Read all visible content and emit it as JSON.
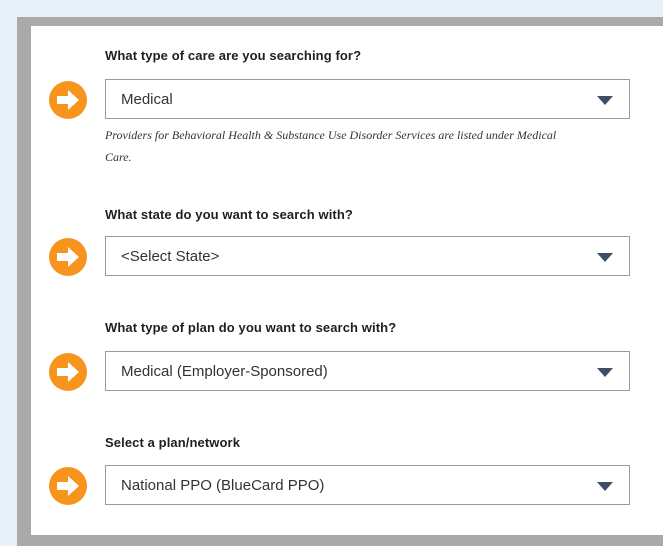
{
  "form": {
    "care_type": {
      "question": "What type of care are you searching for?",
      "value": "Medical",
      "note": "Providers for Behavioral Health & Substance Use Disorder Services are listed under Medical Care."
    },
    "state": {
      "question": "What state do you want to search with?",
      "value": "<Select State>"
    },
    "plan_type": {
      "question": "What type of plan do you want to search with?",
      "value": "Medical (Employer-Sponsored)"
    },
    "plan_network": {
      "question": "Select a plan/network",
      "value": "National PPO (BlueCard PPO)"
    }
  },
  "icons": {
    "step": "arrow-right-circle-icon",
    "dropdown": "caret-down-icon"
  },
  "colors": {
    "accent": "#f7941e",
    "caret": "#3d4f66",
    "page_background": "#e8f1fa",
    "frame": "#a9a9a9"
  }
}
